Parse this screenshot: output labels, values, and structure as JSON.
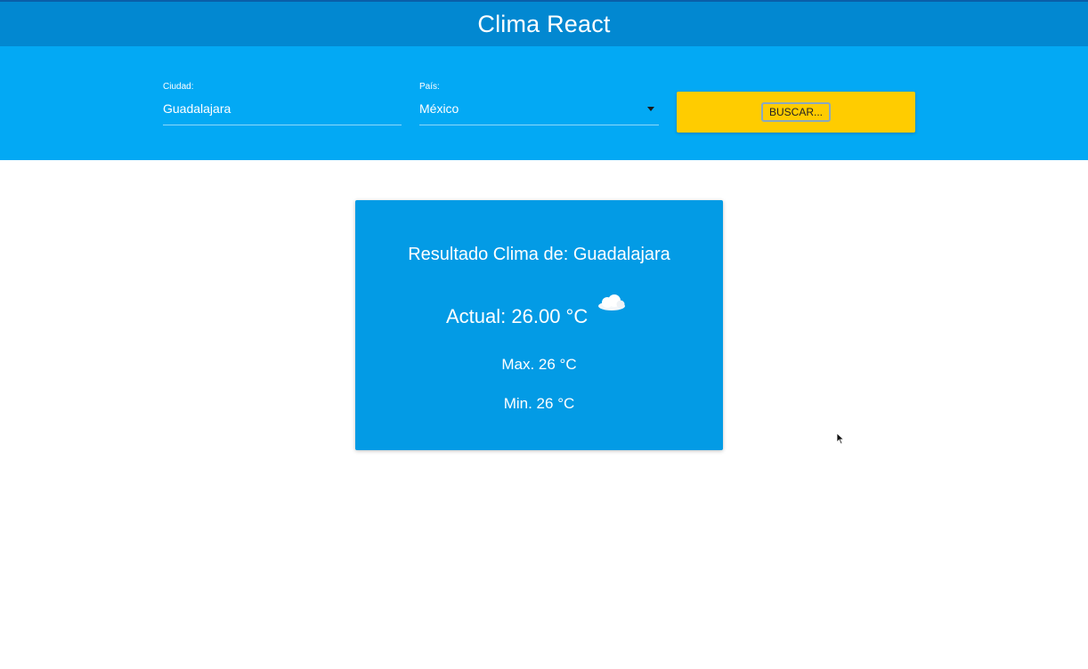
{
  "app": {
    "title": "Clima React"
  },
  "form": {
    "city_label": "Ciudad:",
    "city_value": "Guadalajara",
    "country_label": "País:",
    "country_value": "México",
    "search_button": "BUSCAR..."
  },
  "result": {
    "heading": "Resultado Clima de: Guadalajara",
    "actual": "Actual: 26.00 °C",
    "weather_icon": "cloud-icon",
    "max": "Max. 26 °C",
    "min": "Min. 26 °C"
  },
  "colors": {
    "header": "#0288d1",
    "search_band": "#03a9f4",
    "button": "#ffcc00",
    "card": "#039be5"
  }
}
